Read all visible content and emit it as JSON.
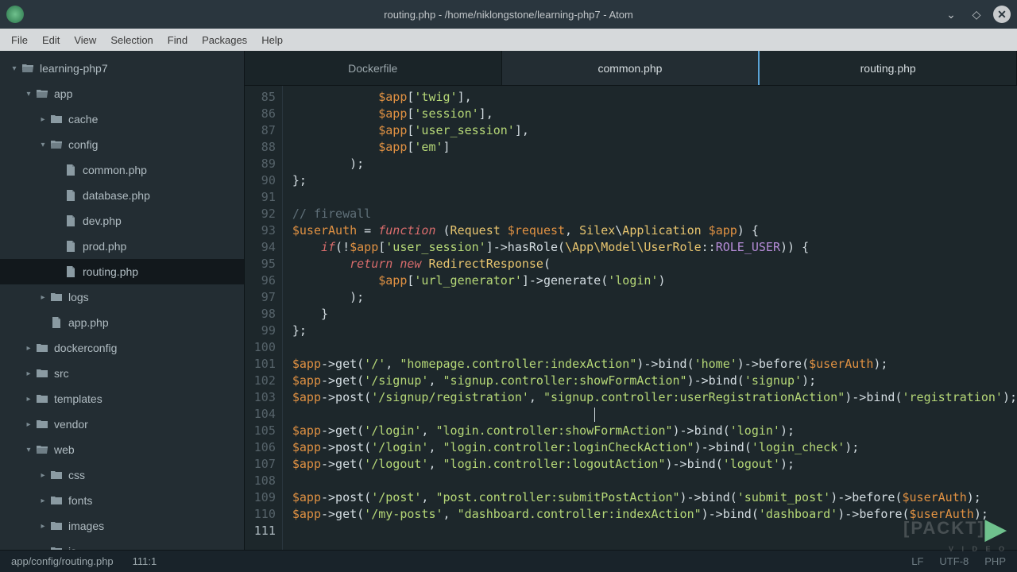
{
  "window": {
    "title": "routing.php - /home/niklongstone/learning-php7 - Atom"
  },
  "menubar": [
    "File",
    "Edit",
    "View",
    "Selection",
    "Find",
    "Packages",
    "Help"
  ],
  "tree": {
    "root": "learning-php7",
    "items": [
      {
        "depth": 0,
        "arrow": "▾",
        "icon": "folder-open",
        "label": "learning-php7"
      },
      {
        "depth": 1,
        "arrow": "▾",
        "icon": "folder-open",
        "label": "app"
      },
      {
        "depth": 2,
        "arrow": "▸",
        "icon": "folder",
        "label": "cache"
      },
      {
        "depth": 2,
        "arrow": "▾",
        "icon": "folder-open",
        "label": "config"
      },
      {
        "depth": 3,
        "arrow": "",
        "icon": "file",
        "label": "common.php"
      },
      {
        "depth": 3,
        "arrow": "",
        "icon": "file",
        "label": "database.php"
      },
      {
        "depth": 3,
        "arrow": "",
        "icon": "file",
        "label": "dev.php"
      },
      {
        "depth": 3,
        "arrow": "",
        "icon": "file",
        "label": "prod.php"
      },
      {
        "depth": 3,
        "arrow": "",
        "icon": "file",
        "label": "routing.php",
        "selected": true
      },
      {
        "depth": 2,
        "arrow": "▸",
        "icon": "folder",
        "label": "logs"
      },
      {
        "depth": 2,
        "arrow": "",
        "icon": "file",
        "label": "app.php"
      },
      {
        "depth": 1,
        "arrow": "▸",
        "icon": "folder",
        "label": "dockerconfig"
      },
      {
        "depth": 1,
        "arrow": "▸",
        "icon": "folder",
        "label": "src"
      },
      {
        "depth": 1,
        "arrow": "▸",
        "icon": "folder",
        "label": "templates"
      },
      {
        "depth": 1,
        "arrow": "▸",
        "icon": "folder",
        "label": "vendor"
      },
      {
        "depth": 1,
        "arrow": "▾",
        "icon": "folder-open",
        "label": "web"
      },
      {
        "depth": 2,
        "arrow": "▸",
        "icon": "folder",
        "label": "css"
      },
      {
        "depth": 2,
        "arrow": "▸",
        "icon": "folder",
        "label": "fonts"
      },
      {
        "depth": 2,
        "arrow": "▸",
        "icon": "folder",
        "label": "images"
      },
      {
        "depth": 2,
        "arrow": "▸",
        "icon": "folder",
        "label": "js"
      }
    ]
  },
  "tabs": [
    {
      "label": "Dockerfile",
      "state": "inactive"
    },
    {
      "label": "common.php",
      "state": "active-border"
    },
    {
      "label": "routing.php",
      "state": "current"
    }
  ],
  "editor": {
    "first_line": 85,
    "lines": [
      {
        "n": 85,
        "seg": [
          [
            "pln",
            "            "
          ],
          [
            "var",
            "$app"
          ],
          [
            "op",
            "["
          ],
          [
            "str",
            "'twig'"
          ],
          [
            "op",
            "],"
          ]
        ]
      },
      {
        "n": 86,
        "seg": [
          [
            "pln",
            "            "
          ],
          [
            "var",
            "$app"
          ],
          [
            "op",
            "["
          ],
          [
            "str",
            "'session'"
          ],
          [
            "op",
            "],"
          ]
        ]
      },
      {
        "n": 87,
        "seg": [
          [
            "pln",
            "            "
          ],
          [
            "var",
            "$app"
          ],
          [
            "op",
            "["
          ],
          [
            "str",
            "'user_session'"
          ],
          [
            "op",
            "],"
          ]
        ]
      },
      {
        "n": 88,
        "seg": [
          [
            "pln",
            "            "
          ],
          [
            "var",
            "$app"
          ],
          [
            "op",
            "["
          ],
          [
            "str",
            "'em'"
          ],
          [
            "op",
            "]"
          ]
        ]
      },
      {
        "n": 89,
        "seg": [
          [
            "pln",
            "        );"
          ]
        ]
      },
      {
        "n": 90,
        "seg": [
          [
            "op",
            "};"
          ]
        ]
      },
      {
        "n": 91,
        "seg": [
          [
            "pln",
            ""
          ]
        ]
      },
      {
        "n": 92,
        "seg": [
          [
            "comment",
            "// firewall"
          ]
        ]
      },
      {
        "n": 93,
        "seg": [
          [
            "var",
            "$userAuth"
          ],
          [
            "op",
            " = "
          ],
          [
            "kw",
            "function"
          ],
          [
            "op",
            " ("
          ],
          [
            "type",
            "Request"
          ],
          [
            "op",
            " "
          ],
          [
            "var",
            "$request"
          ],
          [
            "op",
            ", "
          ],
          [
            "ns",
            "Silex"
          ],
          [
            "op",
            "\\"
          ],
          [
            "type",
            "Application"
          ],
          [
            "op",
            " "
          ],
          [
            "var",
            "$app"
          ],
          [
            "op",
            ") {"
          ]
        ]
      },
      {
        "n": 94,
        "seg": [
          [
            "pln",
            "    "
          ],
          [
            "kw",
            "if"
          ],
          [
            "op",
            "(!"
          ],
          [
            "var",
            "$app"
          ],
          [
            "op",
            "["
          ],
          [
            "str",
            "'user_session'"
          ],
          [
            "op",
            "]->"
          ],
          [
            "fn",
            "hasRole"
          ],
          [
            "op",
            "("
          ],
          [
            "ns",
            "\\App\\Model\\UserRole"
          ],
          [
            "op",
            "::"
          ],
          [
            "const",
            "ROLE_USER"
          ],
          [
            "op",
            ")) {"
          ]
        ]
      },
      {
        "n": 95,
        "seg": [
          [
            "pln",
            "        "
          ],
          [
            "kw",
            "return"
          ],
          [
            "op",
            " "
          ],
          [
            "kw",
            "new"
          ],
          [
            "op",
            " "
          ],
          [
            "type",
            "RedirectResponse"
          ],
          [
            "op",
            "("
          ]
        ]
      },
      {
        "n": 96,
        "seg": [
          [
            "pln",
            "            "
          ],
          [
            "var",
            "$app"
          ],
          [
            "op",
            "["
          ],
          [
            "str",
            "'url_generator'"
          ],
          [
            "op",
            "]->"
          ],
          [
            "fn",
            "generate"
          ],
          [
            "op",
            "("
          ],
          [
            "str",
            "'login'"
          ],
          [
            "op",
            ")"
          ]
        ]
      },
      {
        "n": 97,
        "seg": [
          [
            "pln",
            "        );"
          ]
        ]
      },
      {
        "n": 98,
        "seg": [
          [
            "pln",
            "    }"
          ]
        ]
      },
      {
        "n": 99,
        "seg": [
          [
            "op",
            "};"
          ]
        ]
      },
      {
        "n": 100,
        "seg": [
          [
            "pln",
            ""
          ]
        ]
      },
      {
        "n": 101,
        "seg": [
          [
            "var",
            "$app"
          ],
          [
            "op",
            "->"
          ],
          [
            "fn",
            "get"
          ],
          [
            "op",
            "("
          ],
          [
            "str",
            "'/'"
          ],
          [
            "op",
            ", "
          ],
          [
            "str",
            "\"homepage.controller:indexAction\""
          ],
          [
            "op",
            ")->"
          ],
          [
            "fn",
            "bind"
          ],
          [
            "op",
            "("
          ],
          [
            "str",
            "'home'"
          ],
          [
            "op",
            ")->"
          ],
          [
            "fn",
            "before"
          ],
          [
            "op",
            "("
          ],
          [
            "var",
            "$userAuth"
          ],
          [
            "op",
            ");"
          ]
        ]
      },
      {
        "n": 102,
        "seg": [
          [
            "var",
            "$app"
          ],
          [
            "op",
            "->"
          ],
          [
            "fn",
            "get"
          ],
          [
            "op",
            "("
          ],
          [
            "str",
            "'/signup'"
          ],
          [
            "op",
            ", "
          ],
          [
            "str",
            "\"signup.controller:showFormAction\""
          ],
          [
            "op",
            ")->"
          ],
          [
            "fn",
            "bind"
          ],
          [
            "op",
            "("
          ],
          [
            "str",
            "'signup'"
          ],
          [
            "op",
            ");"
          ]
        ]
      },
      {
        "n": 103,
        "seg": [
          [
            "var",
            "$app"
          ],
          [
            "op",
            "->"
          ],
          [
            "fn",
            "post"
          ],
          [
            "op",
            "("
          ],
          [
            "str",
            "'/signup/registration'"
          ],
          [
            "op",
            ", "
          ],
          [
            "str",
            "\"signup.controller:userRegistrationAction\""
          ],
          [
            "op",
            ")->"
          ],
          [
            "fn",
            "bind"
          ],
          [
            "op",
            "("
          ],
          [
            "str",
            "'registration'"
          ],
          [
            "op",
            ");"
          ]
        ]
      },
      {
        "n": 104,
        "seg": [
          [
            "pln",
            ""
          ]
        ],
        "caret": true
      },
      {
        "n": 105,
        "seg": [
          [
            "var",
            "$app"
          ],
          [
            "op",
            "->"
          ],
          [
            "fn",
            "get"
          ],
          [
            "op",
            "("
          ],
          [
            "str",
            "'/login'"
          ],
          [
            "op",
            ", "
          ],
          [
            "str",
            "\"login.controller:showFormAction\""
          ],
          [
            "op",
            ")->"
          ],
          [
            "fn",
            "bind"
          ],
          [
            "op",
            "("
          ],
          [
            "str",
            "'login'"
          ],
          [
            "op",
            ");"
          ]
        ]
      },
      {
        "n": 106,
        "seg": [
          [
            "var",
            "$app"
          ],
          [
            "op",
            "->"
          ],
          [
            "fn",
            "post"
          ],
          [
            "op",
            "("
          ],
          [
            "str",
            "'/login'"
          ],
          [
            "op",
            ", "
          ],
          [
            "str",
            "\"login.controller:loginCheckAction\""
          ],
          [
            "op",
            ")->"
          ],
          [
            "fn",
            "bind"
          ],
          [
            "op",
            "("
          ],
          [
            "str",
            "'login_check'"
          ],
          [
            "op",
            ");"
          ]
        ]
      },
      {
        "n": 107,
        "seg": [
          [
            "var",
            "$app"
          ],
          [
            "op",
            "->"
          ],
          [
            "fn",
            "get"
          ],
          [
            "op",
            "("
          ],
          [
            "str",
            "'/logout'"
          ],
          [
            "op",
            ", "
          ],
          [
            "str",
            "\"login.controller:logoutAction\""
          ],
          [
            "op",
            ")->"
          ],
          [
            "fn",
            "bind"
          ],
          [
            "op",
            "("
          ],
          [
            "str",
            "'logout'"
          ],
          [
            "op",
            ");"
          ]
        ]
      },
      {
        "n": 108,
        "seg": [
          [
            "pln",
            ""
          ]
        ]
      },
      {
        "n": 109,
        "seg": [
          [
            "var",
            "$app"
          ],
          [
            "op",
            "->"
          ],
          [
            "fn",
            "post"
          ],
          [
            "op",
            "("
          ],
          [
            "str",
            "'/post'"
          ],
          [
            "op",
            ", "
          ],
          [
            "str",
            "\"post.controller:submitPostAction\""
          ],
          [
            "op",
            ")->"
          ],
          [
            "fn",
            "bind"
          ],
          [
            "op",
            "("
          ],
          [
            "str",
            "'submit_post'"
          ],
          [
            "op",
            ")->"
          ],
          [
            "fn",
            "before"
          ],
          [
            "op",
            "("
          ],
          [
            "var",
            "$userAuth"
          ],
          [
            "op",
            ");"
          ]
        ]
      },
      {
        "n": 110,
        "seg": [
          [
            "var",
            "$app"
          ],
          [
            "op",
            "->"
          ],
          [
            "fn",
            "get"
          ],
          [
            "op",
            "("
          ],
          [
            "str",
            "'/my-posts'"
          ],
          [
            "op",
            ", "
          ],
          [
            "str",
            "\"dashboard.controller:indexAction\""
          ],
          [
            "op",
            ")->"
          ],
          [
            "fn",
            "bind"
          ],
          [
            "op",
            "("
          ],
          [
            "str",
            "'dashboard'"
          ],
          [
            "op",
            ")->"
          ],
          [
            "fn",
            "before"
          ],
          [
            "op",
            "("
          ],
          [
            "var",
            "$userAuth"
          ],
          [
            "op",
            ");"
          ]
        ]
      },
      {
        "n": 111,
        "seg": [
          [
            "pln",
            ""
          ]
        ],
        "current": true
      }
    ]
  },
  "statusbar": {
    "path": "app/config/routing.php",
    "position": "111:1",
    "right": [
      "LF",
      "UTF-8",
      "PHP"
    ]
  },
  "watermark": {
    "brand": "[PACKT]",
    "sub": "V I D E O"
  }
}
